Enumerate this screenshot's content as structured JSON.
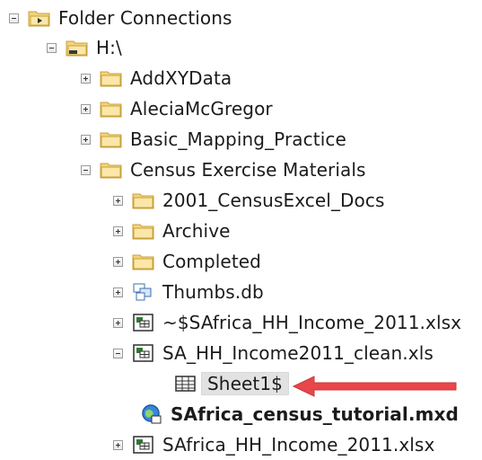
{
  "tree": {
    "rows": [
      {
        "label": "Folder Connections",
        "icon": "folder-connections-icon",
        "state": "expanded"
      },
      {
        "label": "H:\\",
        "icon": "drive-folder-icon",
        "state": "expanded"
      },
      {
        "label": "AddXYData",
        "icon": "folder-icon",
        "state": "collapsed"
      },
      {
        "label": "AleciaMcGregor",
        "icon": "folder-icon",
        "state": "collapsed"
      },
      {
        "label": "Basic_Mapping_Practice",
        "icon": "folder-icon",
        "state": "collapsed"
      },
      {
        "label": "Census Exercise Materials",
        "icon": "folder-icon",
        "state": "expanded"
      },
      {
        "label": "2001_CensusExcel_Docs",
        "icon": "folder-icon",
        "state": "collapsed"
      },
      {
        "label": "Archive",
        "icon": "folder-icon",
        "state": "collapsed"
      },
      {
        "label": "Completed",
        "icon": "folder-icon",
        "state": "collapsed"
      },
      {
        "label": "Thumbs.db",
        "icon": "database-icon",
        "state": "collapsed"
      },
      {
        "label": "~$SAfrica_HH_Income_2011.xlsx",
        "icon": "excel-workbook-icon",
        "state": "collapsed"
      },
      {
        "label": "SA_HH_Income2011_clean.xls",
        "icon": "excel-workbook-icon",
        "state": "expanded"
      },
      {
        "label": "Sheet1$",
        "icon": "table-icon",
        "state": "leaf",
        "selected": true
      },
      {
        "label": "SAfrica_census_tutorial.mxd",
        "icon": "map-document-icon",
        "state": "leaf",
        "bold": true
      },
      {
        "label": "SAfrica_HH_Income_2011.xlsx",
        "icon": "excel-workbook-icon",
        "state": "collapsed"
      }
    ]
  },
  "annotation": {
    "arrow_color": "#e8464a",
    "points_to": "Sheet1$"
  },
  "colors": {
    "folder": "#f3d27a",
    "folder_edge": "#c9a13c",
    "selection": "#e2e2e2"
  }
}
